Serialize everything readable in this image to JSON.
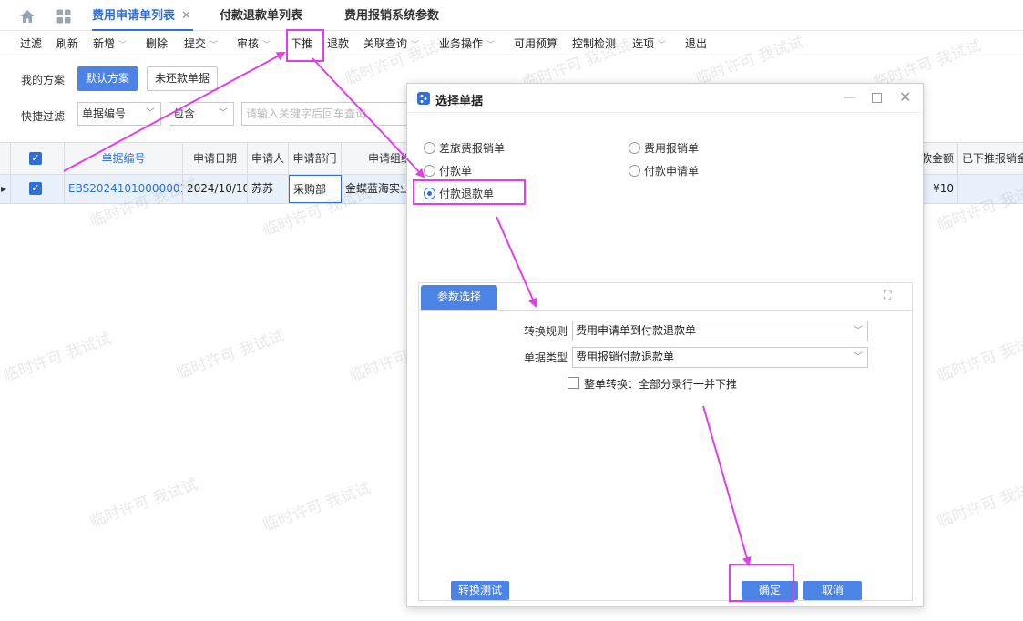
{
  "tabs": {
    "home_icon": "home-icon",
    "apps_icon": "grid-icon",
    "items": [
      {
        "label": "费用申请单列表",
        "active": true,
        "close": "✕"
      },
      {
        "label": "付款退款单列表"
      },
      {
        "label": "费用报销系统参数"
      }
    ]
  },
  "toolbar": {
    "items": [
      {
        "label": "过滤"
      },
      {
        "label": "刷新"
      },
      {
        "label": "新增",
        "dropdown": true
      },
      {
        "label": "删除"
      },
      {
        "label": "提交",
        "dropdown": true
      },
      {
        "label": "审核",
        "dropdown": true
      },
      {
        "label": "下推"
      },
      {
        "label": "退款"
      },
      {
        "label": "关联查询",
        "dropdown": true
      },
      {
        "label": "业务操作",
        "dropdown": true
      },
      {
        "label": "可用预算"
      },
      {
        "label": "控制检测"
      },
      {
        "label": "选项",
        "dropdown": true
      },
      {
        "label": "退出"
      }
    ]
  },
  "filter": {
    "scheme_label": "我的方案",
    "default_scheme": "默认方案",
    "unpaid_scheme": "未还款单据",
    "quick_filter_label": "快捷过滤",
    "field_select": "单据编号",
    "op_select": "包含",
    "search_placeholder": "请输入关键字后回车查询"
  },
  "grid": {
    "headers": [
      "单据编号",
      "申请日期",
      "申请人",
      "申请部门",
      "申请组织",
      "款金额",
      "已下推报销金"
    ],
    "row": {
      "bill_no": "EBS20241010000001",
      "date": "2024/10/10",
      "applicant": "苏苏",
      "dept": "采购部",
      "org": "金蝶蓝海实业",
      "amount": "¥10"
    }
  },
  "watermark": "临时许可 我试试",
  "dialog": {
    "title": "选择单据",
    "options": [
      {
        "label": "差旅费报销单",
        "selected": false
      },
      {
        "label": "费用报销单",
        "selected": false
      },
      {
        "label": "付款单",
        "selected": false
      },
      {
        "label": "付款申请单",
        "selected": false
      },
      {
        "label": "付款退款单",
        "selected": true
      }
    ],
    "param_tab": "参数选择",
    "rule_label": "转换规则",
    "rule_value": "费用申请单到付款退款单",
    "type_label": "单据类型",
    "type_value": "费用报销付款退款单",
    "whole_label": "整单转换：全部分录行一并下推",
    "test_button": "转换测试",
    "ok_button": "确定",
    "cancel_button": "取消"
  },
  "colors": {
    "accent": "#2f6fd6",
    "button": "#4c83e6",
    "annotation": "#e03fe8"
  }
}
